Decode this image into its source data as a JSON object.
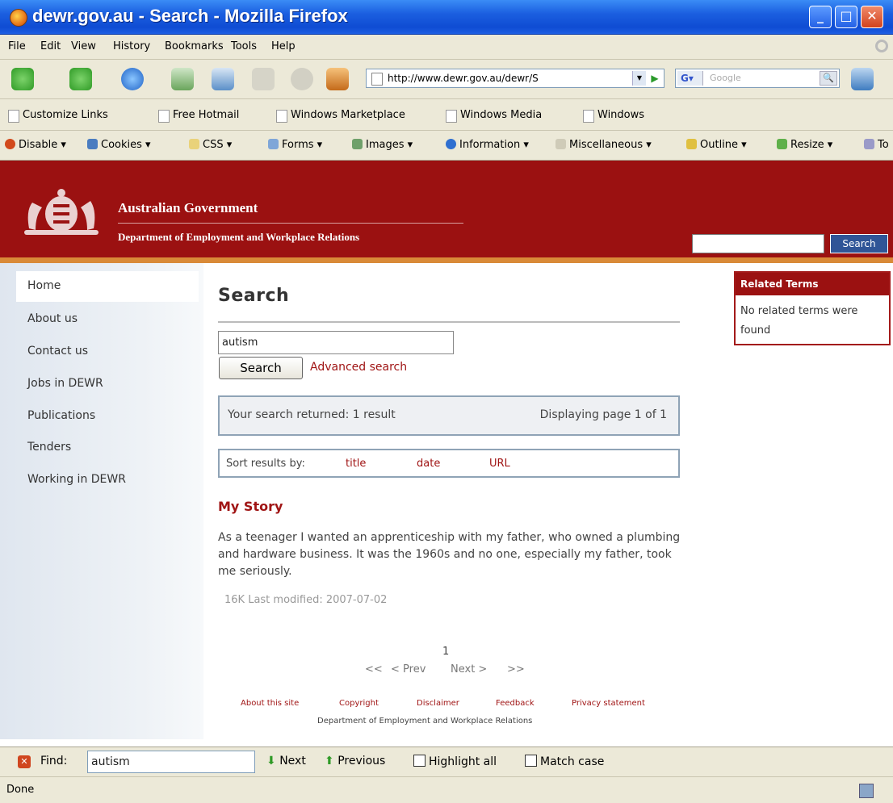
{
  "window": {
    "title": "dewr.gov.au - Search - Mozilla Firefox"
  },
  "menu": [
    "File",
    "Edit",
    "View",
    "History",
    "Bookmarks",
    "Tools",
    "Help"
  ],
  "nav": {
    "url": "http://www.dewr.gov.au/dewr/S",
    "search_placeholder": "Google"
  },
  "links_bar": [
    "Customize Links",
    "Free Hotmail",
    "Windows Marketplace",
    "Windows Media",
    "Windows"
  ],
  "dev_bar": [
    "Disable ▾",
    "Cookies ▾",
    "CSS ▾",
    "Forms ▾",
    "Images ▾",
    "Information ▾",
    "Miscellaneous ▾",
    "Outline ▾",
    "Resize ▾",
    "To"
  ],
  "site": {
    "gov_name": "Australian Government",
    "dept_name": "Department of Employment and Workplace Relations",
    "header_search_button": "Search"
  },
  "sidebar": [
    "Home",
    "About us",
    "Contact us",
    "Jobs in DEWR",
    "Publications",
    "Tenders",
    "Working in DEWR"
  ],
  "main": {
    "heading": "Search",
    "query": "autism",
    "search_button": "Search",
    "advanced_link": "Advanced search",
    "results_summary": "Your search returned: 1 result",
    "page_display": "Displaying page 1 of 1",
    "sort_label": "Sort results by:",
    "sort_title": "title",
    "sort_date": "date",
    "sort_url": "URL",
    "result": {
      "title": "My Story",
      "snippet": "As a teenager I wanted an apprenticeship with my father, who owned a plumbing and hardware business. It was the 1960s and no one, especially my father, took me seriously.",
      "meta": "16K  Last modified: 2007-07-02"
    },
    "pagination": {
      "current": "1",
      "first": "<<",
      "prev": "< Prev",
      "next": "Next >",
      "last": ">>"
    }
  },
  "footer": {
    "links": [
      "About this site",
      "Copyright",
      "Disclaimer",
      "Feedback",
      "Privacy statement"
    ],
    "dept": "Department of Employment and Workplace Relations"
  },
  "related": {
    "title": "Related Terms",
    "body": "No related terms were found"
  },
  "findbar": {
    "label": "Find:",
    "value": "autism",
    "next": "Next",
    "previous": "Previous",
    "highlight": "Highlight all",
    "match_case": "Match case"
  },
  "status": {
    "text": "Done"
  }
}
